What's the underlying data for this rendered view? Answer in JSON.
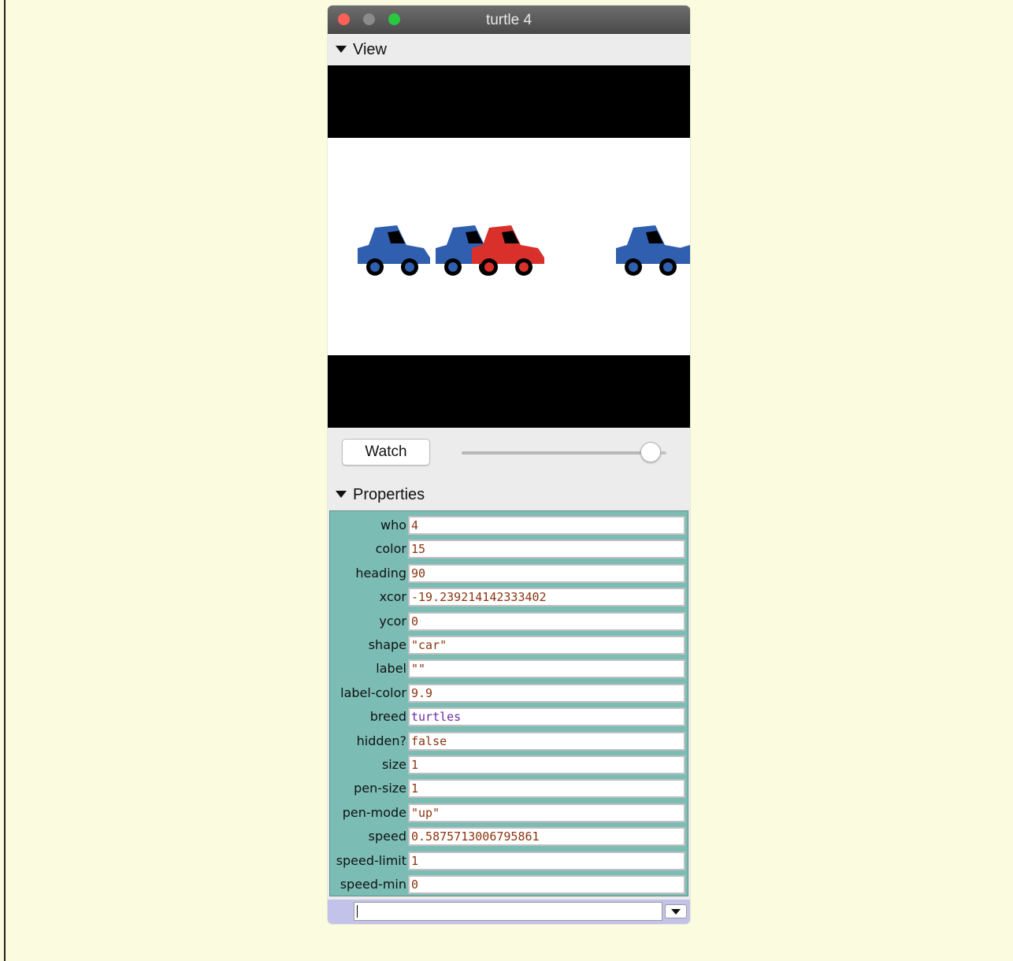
{
  "window": {
    "title": "turtle 4"
  },
  "view_section": {
    "label": "View"
  },
  "controls": {
    "watch_label": "Watch",
    "slider_value": 0.92
  },
  "properties_section": {
    "label": "Properties"
  },
  "properties": [
    {
      "name": "who",
      "value": "4"
    },
    {
      "name": "color",
      "value": "15"
    },
    {
      "name": "heading",
      "value": "90"
    },
    {
      "name": "xcor",
      "value": "-19.239214142333402"
    },
    {
      "name": "ycor",
      "value": "0"
    },
    {
      "name": "shape",
      "value": "\"car\""
    },
    {
      "name": "label",
      "value": "\"\""
    },
    {
      "name": "label-color",
      "value": "9.9"
    },
    {
      "name": "breed",
      "value": "turtles"
    },
    {
      "name": "hidden?",
      "value": "false"
    },
    {
      "name": "size",
      "value": "1"
    },
    {
      "name": "pen-size",
      "value": "1"
    },
    {
      "name": "pen-mode",
      "value": "\"up\""
    },
    {
      "name": "speed",
      "value": "0.5875713006795861"
    },
    {
      "name": "speed-limit",
      "value": "1"
    },
    {
      "name": "speed-min",
      "value": "0"
    }
  ],
  "colors": {
    "car_blue": "#2f5fae",
    "car_red": "#d9302b",
    "prop_value_text": "#8a3410",
    "breed_text": "#6c2aa3"
  }
}
